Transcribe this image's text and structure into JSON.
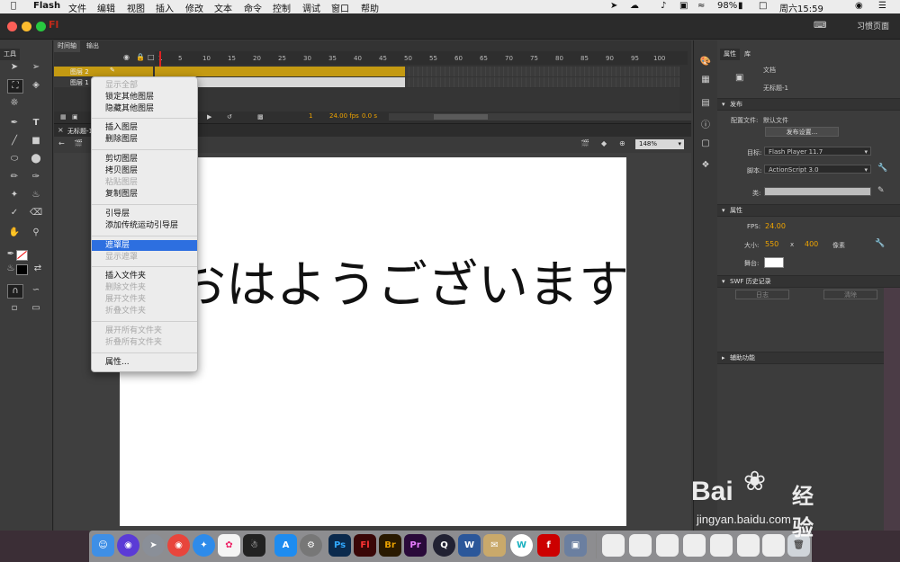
{
  "menubar": {
    "app": "Flash",
    "items": [
      "文件",
      "编辑",
      "视图",
      "插入",
      "修改",
      "文本",
      "命令",
      "控制",
      "调试",
      "窗口",
      "帮助"
    ],
    "battery": "98%",
    "clock": "周六15:59"
  },
  "titlebar": {
    "app_badge": "Fl",
    "workspace": "习惯页面"
  },
  "tools": {
    "tab": "工具"
  },
  "timeline": {
    "tabs": [
      "时间轴",
      "输出"
    ],
    "layers": [
      "图层 2",
      "图层 1"
    ],
    "frame_numbers": [
      "1",
      "5",
      "10",
      "15",
      "20",
      "25",
      "30",
      "35",
      "40",
      "45",
      "50",
      "55",
      "60",
      "65",
      "70",
      "75",
      "80",
      "85",
      "90",
      "95",
      "100"
    ],
    "status": {
      "frame": "1",
      "fps": "24.00 fps",
      "time": "0.0 s"
    }
  },
  "stage": {
    "tab": "无标题-1",
    "zoom": "148%",
    "text": "おはようございます"
  },
  "context_menu": {
    "groups": [
      [
        {
          "label": "显示全部",
          "disabled": true
        },
        {
          "label": "锁定其他图层",
          "disabled": false
        },
        {
          "label": "隐藏其他图层",
          "disabled": false
        }
      ],
      [
        {
          "label": "插入图层",
          "disabled": false
        },
        {
          "label": "删除图层",
          "disabled": false
        }
      ],
      [
        {
          "label": "剪切图层",
          "disabled": false
        },
        {
          "label": "拷贝图层",
          "disabled": false
        },
        {
          "label": "粘贴图层",
          "disabled": true
        },
        {
          "label": "复制图层",
          "disabled": false
        }
      ],
      [
        {
          "label": "引导层",
          "disabled": false
        },
        {
          "label": "添加传统运动引导层",
          "disabled": false
        }
      ],
      [
        {
          "label": "遮罩层",
          "disabled": false,
          "selected": true
        },
        {
          "label": "显示遮罩",
          "disabled": true
        }
      ],
      [
        {
          "label": "插入文件夹",
          "disabled": false
        },
        {
          "label": "删除文件夹",
          "disabled": true
        },
        {
          "label": "展开文件夹",
          "disabled": true
        },
        {
          "label": "折叠文件夹",
          "disabled": true
        }
      ],
      [
        {
          "label": "展开所有文件夹",
          "disabled": true
        },
        {
          "label": "折叠所有文件夹",
          "disabled": true
        }
      ],
      [
        {
          "label": "属性...",
          "disabled": false
        }
      ]
    ]
  },
  "properties": {
    "tabs": [
      "属性",
      "库"
    ],
    "doc_type": "文档",
    "doc_name": "无标题-1",
    "publish_section": "发布",
    "profile_label": "配置文件:",
    "profile_value": "默认文件",
    "publish_settings_btn": "发布设置...",
    "target_label": "目标:",
    "target_value": "Flash Player 11.7",
    "script_label": "脚本:",
    "script_value": "ActionScript 3.0",
    "class_label": "类:",
    "props_section": "属性",
    "fps_label": "FPS:",
    "fps_value": "24.00",
    "size_label": "大小:",
    "width": "550",
    "x": "x",
    "height": "400",
    "unit": "像素",
    "stage_label": "舞台:",
    "swf_section": "SWF 历史记录",
    "log_btn": "日志",
    "clear_btn": "清除",
    "access_section": "辅助功能"
  },
  "dock": {
    "apps": [
      "Finder",
      "Siri",
      "Launchpad",
      "Chrome",
      "Safari",
      "Photos",
      "QQ",
      "App Store",
      "System Preferences",
      "Ps",
      "Fl",
      "Br",
      "Pr",
      "QuickTime",
      "Word",
      "Preview",
      "W",
      "Flash Player",
      "Image Capture"
    ]
  },
  "watermark": {
    "brand": "Bai",
    "brand2": "经验",
    "url": "jingyan.baidu.com"
  },
  "colors": {
    "accent": "#2d6fe0",
    "orange": "#f0a400",
    "layer_highlight": "#c49a12"
  }
}
